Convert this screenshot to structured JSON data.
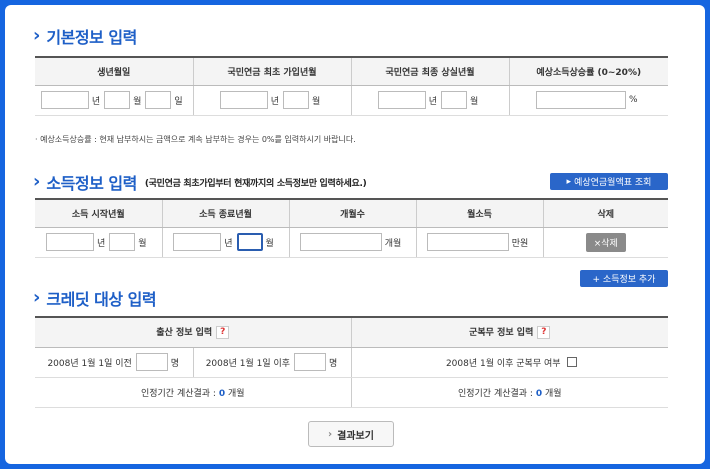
{
  "basic": {
    "title": "기본정보 입력",
    "headers": [
      "생년월일",
      "국민연금 최초 가입년월",
      "국민연금 최종 상실년월",
      "예상소득상승률 (0~20%)"
    ],
    "unit_year": "년",
    "unit_month": "월",
    "unit_day": "일",
    "unit_percent": "%",
    "note": "· 예상소득상승률 : 현재 납부하시는 금액으로 계속 납부하는 경우는 0%를 입력하시기 바랍니다."
  },
  "income": {
    "title": "소득정보 입력",
    "subtitle": "(국민연금 최초가입부터 현재까지의 소득정보만 입력하세요.)",
    "lookup_button": "예상연금월액표 조회",
    "headers": [
      "소득 시작년월",
      "소득 종료년월",
      "개월수",
      "월소득",
      "삭제"
    ],
    "unit_year": "년",
    "unit_month": "월",
    "unit_months": "개월",
    "unit_manwon": "만원",
    "delete_button": "×삭제",
    "add_button": "+ 소득정보 추가"
  },
  "credit": {
    "title": "크레딧 대상 입력",
    "birth_header": "출산 정보 입력",
    "military_header": "군복무 정보 입력",
    "help": "?",
    "before_label": "2008년 1월 1일 이전",
    "after_label": "2008년 1월 1일 이후",
    "unit_person": "명",
    "military_label": "2008년 1월 이후 군복무 여부",
    "result_prefix": "인정기간 계산결과 : ",
    "result_value_birth": "0",
    "result_value_military": "0",
    "result_unit": " 개월"
  },
  "result_button": "결과보기"
}
